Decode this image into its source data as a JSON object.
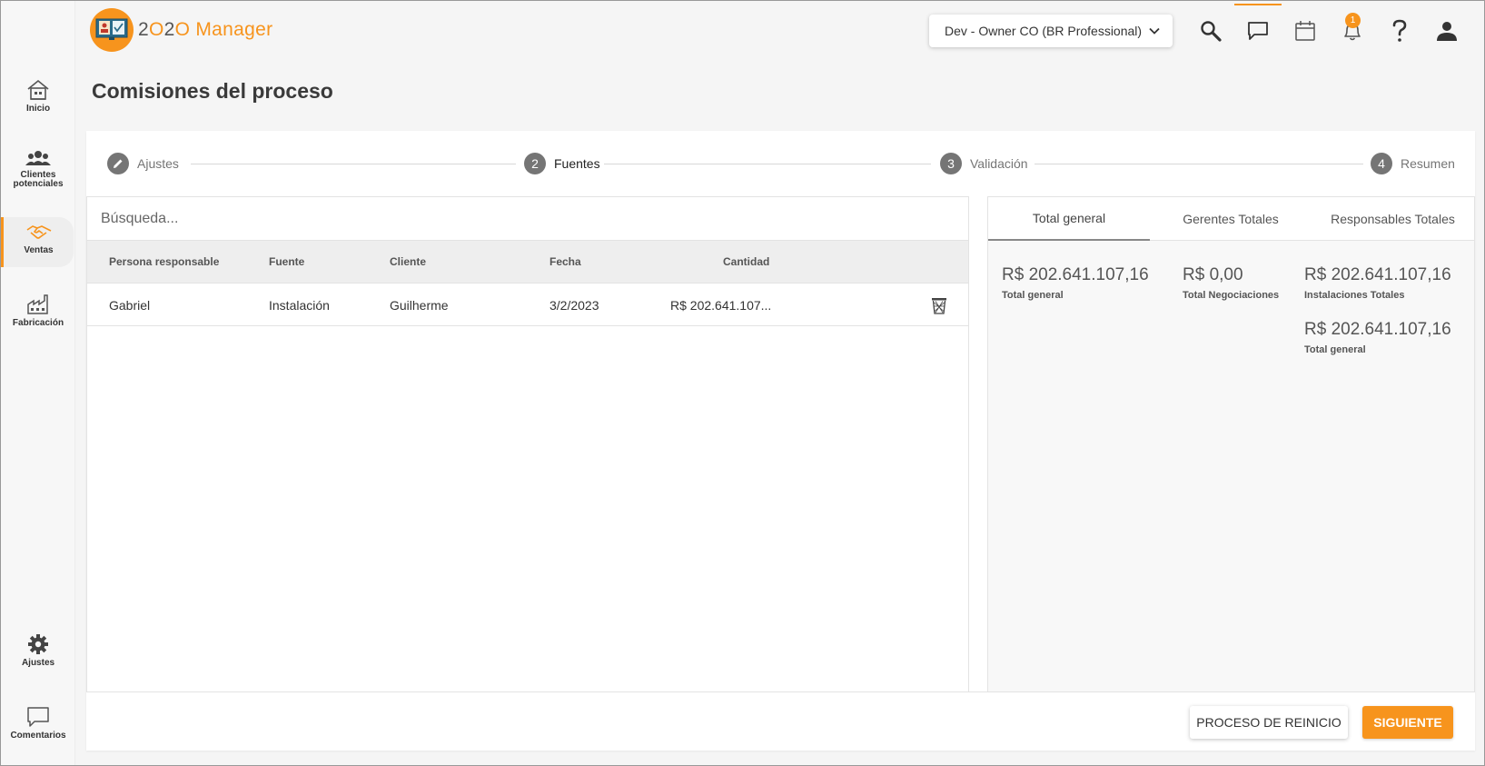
{
  "app": {
    "logo_prefix_1": "2",
    "logo_prefix_o": "O",
    "logo_prefix_2": "2",
    "logo_prefix_o2": "O",
    "logo_suffix": " Manager"
  },
  "sidebar": {
    "items": [
      {
        "label": "Inicio",
        "icon": "house-icon"
      },
      {
        "label": "Clientes\npotenciales",
        "icon": "users-icon"
      },
      {
        "label": "Ventas",
        "icon": "handshake-icon"
      },
      {
        "label": "Fabricación",
        "icon": "factory-icon"
      },
      {
        "label": "Ajustes",
        "icon": "gear-icon"
      },
      {
        "label": "Comentarios",
        "icon": "comment-icon"
      }
    ]
  },
  "header": {
    "company": "Dev - Owner CO (BR Professional)",
    "notification_count": "1",
    "icons": [
      "search-icon",
      "chat-icon",
      "calendar-icon",
      "bell-icon",
      "help-icon",
      "user-icon"
    ]
  },
  "page": {
    "title": "Comisiones del proceso"
  },
  "stepper": {
    "steps": [
      {
        "number": "",
        "label": "Ajustes",
        "state": "done"
      },
      {
        "number": "2",
        "label": "Fuentes",
        "state": "current"
      },
      {
        "number": "3",
        "label": "Validación",
        "state": "pending"
      },
      {
        "number": "4",
        "label": "Resumen",
        "state": "pending"
      }
    ]
  },
  "search": {
    "placeholder": "Búsqueda...",
    "value": ""
  },
  "table": {
    "columns": [
      "Persona responsable",
      "Fuente",
      "Cliente",
      "Fecha",
      "Cantidad"
    ],
    "rows": [
      {
        "persona": "Gabriel",
        "fuente": "Instalación",
        "cliente": "Guilherme",
        "fecha": "3/2/2023",
        "cantidad": "R$ 202.641.107..."
      }
    ]
  },
  "summary": {
    "tabs": [
      "Total general",
      "Gerentes Totales",
      "Responsables Totales"
    ],
    "active_tab": 0,
    "totals": [
      {
        "value": "R$ 202.641.107,16",
        "label": "Total general"
      },
      {
        "value": "R$ 0,00",
        "label": "Total Negociaciones"
      },
      {
        "value": "R$ 202.641.107,16",
        "label": "Instalaciones Totales"
      },
      {
        "value": "R$ 202.641.107,16",
        "label": "Total general"
      }
    ]
  },
  "footer": {
    "reset_label": "PROCESO DE REINICIO",
    "next_label": "SIGUIENTE"
  },
  "colors": {
    "accent": "#f7941d",
    "step_circle": "#757575"
  }
}
